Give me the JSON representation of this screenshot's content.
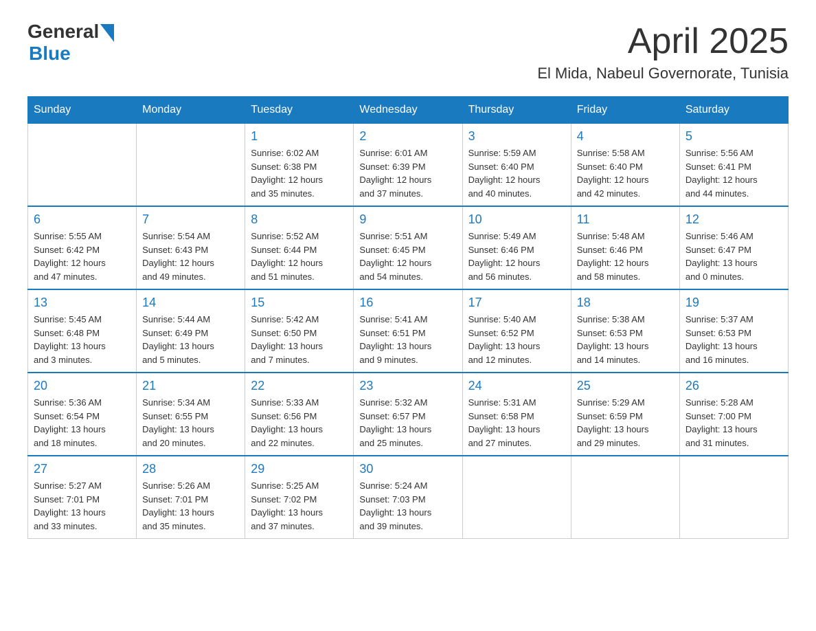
{
  "header": {
    "logo_general": "General",
    "logo_blue": "Blue",
    "month_title": "April 2025",
    "location": "El Mida, Nabeul Governorate, Tunisia"
  },
  "weekdays": [
    "Sunday",
    "Monday",
    "Tuesday",
    "Wednesday",
    "Thursday",
    "Friday",
    "Saturday"
  ],
  "weeks": [
    [
      {
        "day": "",
        "info": ""
      },
      {
        "day": "",
        "info": ""
      },
      {
        "day": "1",
        "info": "Sunrise: 6:02 AM\nSunset: 6:38 PM\nDaylight: 12 hours\nand 35 minutes."
      },
      {
        "day": "2",
        "info": "Sunrise: 6:01 AM\nSunset: 6:39 PM\nDaylight: 12 hours\nand 37 minutes."
      },
      {
        "day": "3",
        "info": "Sunrise: 5:59 AM\nSunset: 6:40 PM\nDaylight: 12 hours\nand 40 minutes."
      },
      {
        "day": "4",
        "info": "Sunrise: 5:58 AM\nSunset: 6:40 PM\nDaylight: 12 hours\nand 42 minutes."
      },
      {
        "day": "5",
        "info": "Sunrise: 5:56 AM\nSunset: 6:41 PM\nDaylight: 12 hours\nand 44 minutes."
      }
    ],
    [
      {
        "day": "6",
        "info": "Sunrise: 5:55 AM\nSunset: 6:42 PM\nDaylight: 12 hours\nand 47 minutes."
      },
      {
        "day": "7",
        "info": "Sunrise: 5:54 AM\nSunset: 6:43 PM\nDaylight: 12 hours\nand 49 minutes."
      },
      {
        "day": "8",
        "info": "Sunrise: 5:52 AM\nSunset: 6:44 PM\nDaylight: 12 hours\nand 51 minutes."
      },
      {
        "day": "9",
        "info": "Sunrise: 5:51 AM\nSunset: 6:45 PM\nDaylight: 12 hours\nand 54 minutes."
      },
      {
        "day": "10",
        "info": "Sunrise: 5:49 AM\nSunset: 6:46 PM\nDaylight: 12 hours\nand 56 minutes."
      },
      {
        "day": "11",
        "info": "Sunrise: 5:48 AM\nSunset: 6:46 PM\nDaylight: 12 hours\nand 58 minutes."
      },
      {
        "day": "12",
        "info": "Sunrise: 5:46 AM\nSunset: 6:47 PM\nDaylight: 13 hours\nand 0 minutes."
      }
    ],
    [
      {
        "day": "13",
        "info": "Sunrise: 5:45 AM\nSunset: 6:48 PM\nDaylight: 13 hours\nand 3 minutes."
      },
      {
        "day": "14",
        "info": "Sunrise: 5:44 AM\nSunset: 6:49 PM\nDaylight: 13 hours\nand 5 minutes."
      },
      {
        "day": "15",
        "info": "Sunrise: 5:42 AM\nSunset: 6:50 PM\nDaylight: 13 hours\nand 7 minutes."
      },
      {
        "day": "16",
        "info": "Sunrise: 5:41 AM\nSunset: 6:51 PM\nDaylight: 13 hours\nand 9 minutes."
      },
      {
        "day": "17",
        "info": "Sunrise: 5:40 AM\nSunset: 6:52 PM\nDaylight: 13 hours\nand 12 minutes."
      },
      {
        "day": "18",
        "info": "Sunrise: 5:38 AM\nSunset: 6:53 PM\nDaylight: 13 hours\nand 14 minutes."
      },
      {
        "day": "19",
        "info": "Sunrise: 5:37 AM\nSunset: 6:53 PM\nDaylight: 13 hours\nand 16 minutes."
      }
    ],
    [
      {
        "day": "20",
        "info": "Sunrise: 5:36 AM\nSunset: 6:54 PM\nDaylight: 13 hours\nand 18 minutes."
      },
      {
        "day": "21",
        "info": "Sunrise: 5:34 AM\nSunset: 6:55 PM\nDaylight: 13 hours\nand 20 minutes."
      },
      {
        "day": "22",
        "info": "Sunrise: 5:33 AM\nSunset: 6:56 PM\nDaylight: 13 hours\nand 22 minutes."
      },
      {
        "day": "23",
        "info": "Sunrise: 5:32 AM\nSunset: 6:57 PM\nDaylight: 13 hours\nand 25 minutes."
      },
      {
        "day": "24",
        "info": "Sunrise: 5:31 AM\nSunset: 6:58 PM\nDaylight: 13 hours\nand 27 minutes."
      },
      {
        "day": "25",
        "info": "Sunrise: 5:29 AM\nSunset: 6:59 PM\nDaylight: 13 hours\nand 29 minutes."
      },
      {
        "day": "26",
        "info": "Sunrise: 5:28 AM\nSunset: 7:00 PM\nDaylight: 13 hours\nand 31 minutes."
      }
    ],
    [
      {
        "day": "27",
        "info": "Sunrise: 5:27 AM\nSunset: 7:01 PM\nDaylight: 13 hours\nand 33 minutes."
      },
      {
        "day": "28",
        "info": "Sunrise: 5:26 AM\nSunset: 7:01 PM\nDaylight: 13 hours\nand 35 minutes."
      },
      {
        "day": "29",
        "info": "Sunrise: 5:25 AM\nSunset: 7:02 PM\nDaylight: 13 hours\nand 37 minutes."
      },
      {
        "day": "30",
        "info": "Sunrise: 5:24 AM\nSunset: 7:03 PM\nDaylight: 13 hours\nand 39 minutes."
      },
      {
        "day": "",
        "info": ""
      },
      {
        "day": "",
        "info": ""
      },
      {
        "day": "",
        "info": ""
      }
    ]
  ]
}
